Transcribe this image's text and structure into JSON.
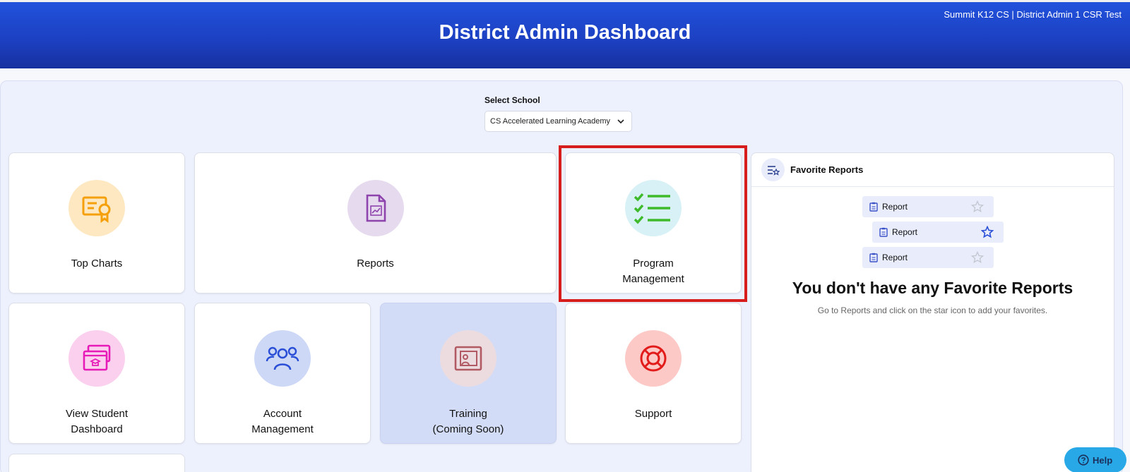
{
  "header": {
    "title": "District Admin Dashboard",
    "user": "Summit K12 CS | District Admin 1 CSR Test"
  },
  "school_select": {
    "label": "Select School",
    "value": "CS Accelerated Learning Academy"
  },
  "tiles": {
    "top_charts": {
      "label": "Top Charts",
      "icon": "certificate-icon",
      "color": "#f5a00a"
    },
    "reports": {
      "label": "Reports",
      "icon": "report-document-icon",
      "color": "#8e44ad"
    },
    "program_management": {
      "line1": "Program",
      "line2": "Management",
      "icon": "checklist-icon",
      "color": "#3fba2a"
    },
    "view_student_dashboard": {
      "line1": "View Student",
      "line2": "Dashboard",
      "icon": "student-dashboard-icon",
      "color": "#e61bb8"
    },
    "account_management": {
      "line1": "Account",
      "line2": "Management",
      "icon": "users-icon",
      "color": "#2a4fd6"
    },
    "training": {
      "line1": "Training",
      "line2": "(Coming Soon)",
      "icon": "presentation-icon",
      "color": "#b15a63"
    },
    "support": {
      "label": "Support",
      "icon": "lifebuoy-icon",
      "color": "#e21b1b"
    }
  },
  "favorites": {
    "title": "Favorite Reports",
    "chips": [
      "Report",
      "Report",
      "Report"
    ],
    "empty_title": "You don't have any Favorite Reports",
    "empty_subtitle": "Go to Reports and click on the star icon to add your favorites."
  },
  "help": {
    "label": "Help"
  }
}
